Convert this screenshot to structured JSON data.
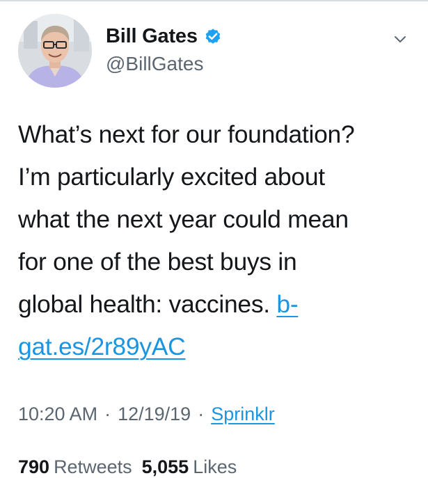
{
  "tweet": {
    "author": {
      "display_name": "Bill Gates",
      "handle": "@BillGates",
      "verified": true,
      "avatar_icon": "profile-photo"
    },
    "text_lines": [
      "What’s next for our foundation?",
      "I’m particularly excited about",
      "what the next year could mean",
      "for one of the best buys in"
    ],
    "text_line5_prefix": "global health: vaccines. ",
    "link_part1": "b-",
    "link_part2": "gat.es/2r89yAC",
    "time": "10:20 AM",
    "date": "12/19/19",
    "separator": "·",
    "source": "Sprinklr",
    "retweets": "790",
    "retweets_label": "Retweets",
    "likes": "5,055",
    "likes_label": "Likes"
  },
  "icons": {
    "verified": "verified-badge-icon",
    "menu": "chevron-down-icon"
  },
  "colors": {
    "link": "#1b95e0",
    "verified": "#1da1f2",
    "muted": "#5b6670",
    "text": "#14171a"
  }
}
